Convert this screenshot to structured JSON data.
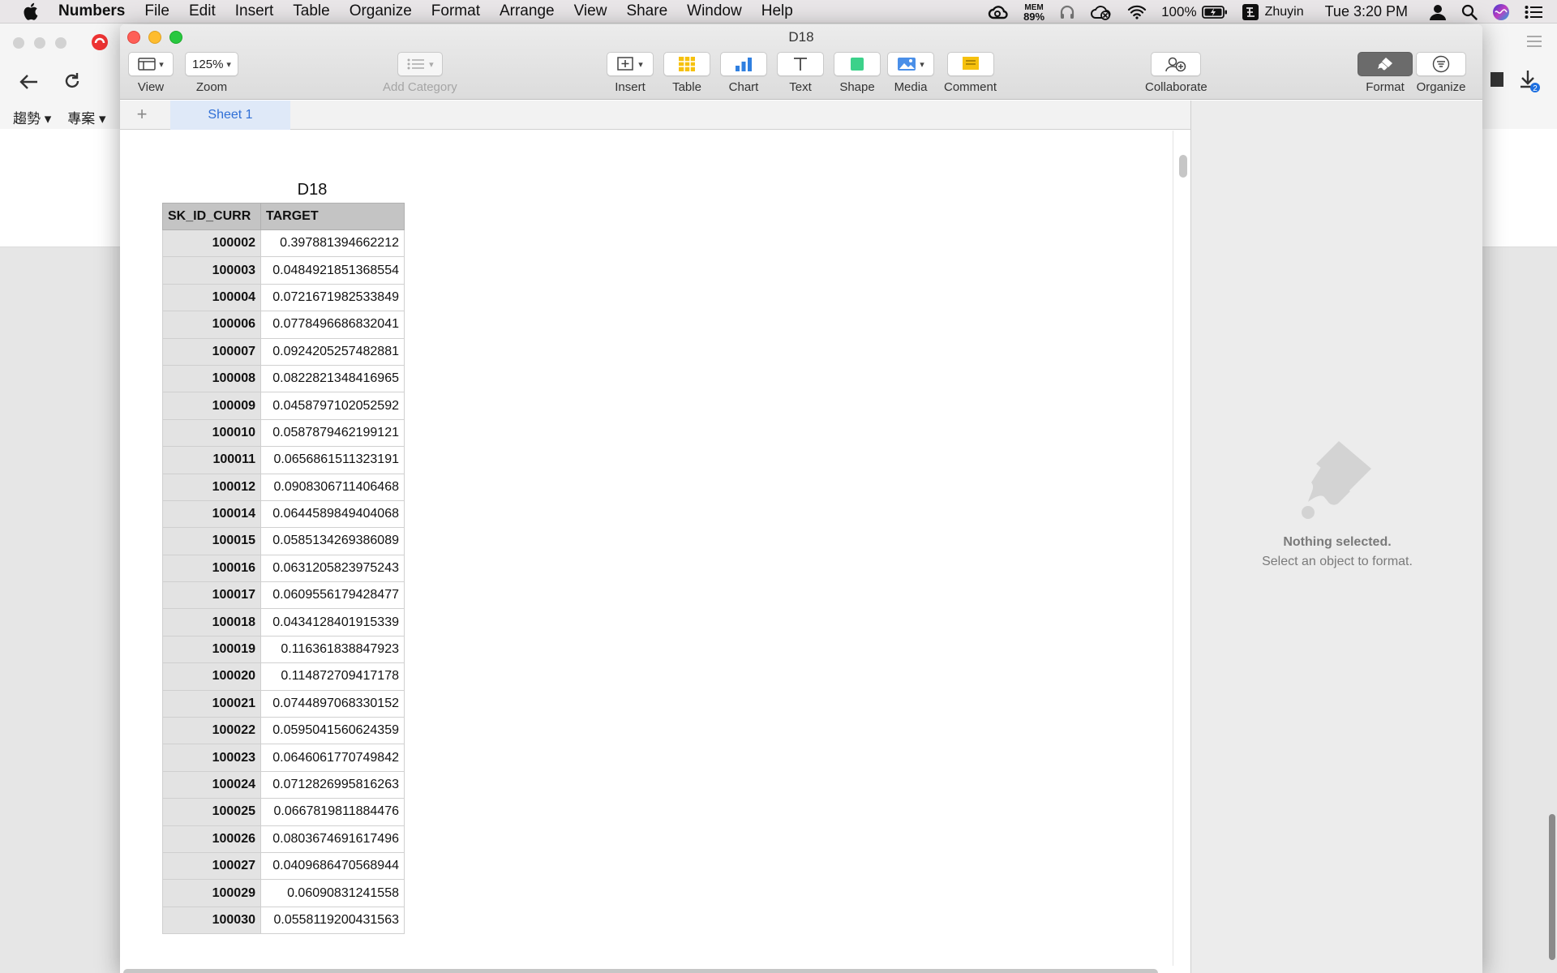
{
  "menubar": {
    "app_name": "Numbers",
    "items": [
      "File",
      "Edit",
      "Insert",
      "Table",
      "Organize",
      "Format",
      "Arrange",
      "View",
      "Share",
      "Window",
      "Help"
    ],
    "mem_label": "MEM",
    "mem_pct": "89%",
    "battery": "100%",
    "input_method": "Zhuyin",
    "clock": "Tue 3:20 PM"
  },
  "browser_bg": {
    "bookmark_1": "趨勢 ▾",
    "bookmark_2": "專案 ▾",
    "download_badge": "2"
  },
  "window": {
    "title": "D18",
    "toolbar": {
      "view": "View",
      "zoom_value": "125%",
      "zoom": "Zoom",
      "add_category": "Add Category",
      "insert": "Insert",
      "table": "Table",
      "chart": "Chart",
      "text": "Text",
      "shape": "Shape",
      "media": "Media",
      "comment": "Comment",
      "collaborate": "Collaborate",
      "format": "Format",
      "organize": "Organize"
    },
    "sheet_tab": "Sheet 1",
    "add_sheet": "+"
  },
  "table": {
    "title": "D18",
    "headers": [
      "SK_ID_CURR",
      "TARGET"
    ],
    "rows": [
      [
        "100002",
        "0.397881394662212"
      ],
      [
        "100003",
        "0.0484921851368554"
      ],
      [
        "100004",
        "0.0721671982533849"
      ],
      [
        "100006",
        "0.0778496686832041"
      ],
      [
        "100007",
        "0.0924205257482881"
      ],
      [
        "100008",
        "0.0822821348416965"
      ],
      [
        "100009",
        "0.0458797102052592"
      ],
      [
        "100010",
        "0.0587879462199121"
      ],
      [
        "100011",
        "0.0656861511323191"
      ],
      [
        "100012",
        "0.0908306711406468"
      ],
      [
        "100014",
        "0.0644589849404068"
      ],
      [
        "100015",
        "0.0585134269386089"
      ],
      [
        "100016",
        "0.0631205823975243"
      ],
      [
        "100017",
        "0.0609556179428477"
      ],
      [
        "100018",
        "0.0434128401915339"
      ],
      [
        "100019",
        "0.116361838847923"
      ],
      [
        "100020",
        "0.114872709417178"
      ],
      [
        "100021",
        "0.0744897068330152"
      ],
      [
        "100022",
        "0.0595041560624359"
      ],
      [
        "100023",
        "0.0646061770749842"
      ],
      [
        "100024",
        "0.0712826995816263"
      ],
      [
        "100025",
        "0.0667819811884476"
      ],
      [
        "100026",
        "0.0803674691617496"
      ],
      [
        "100027",
        "0.0409686470568944"
      ],
      [
        "100029",
        "0.06090831241558"
      ],
      [
        "100030",
        "0.0558119200431563"
      ]
    ]
  },
  "inspector": {
    "title": "Nothing selected.",
    "hint": "Select an object to format."
  }
}
